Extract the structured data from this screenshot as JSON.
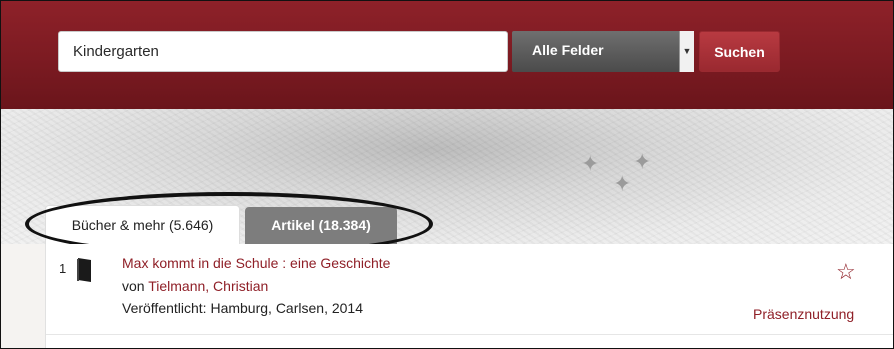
{
  "search": {
    "query": "Kindergarten",
    "field_selected": "Alle Felder",
    "button_label": "Suchen"
  },
  "tabs": [
    {
      "label": "Bücher & mehr (5.646)",
      "active": true
    },
    {
      "label": "Artikel (18.384)",
      "active": false
    }
  ],
  "results": [
    {
      "number": "1",
      "icon": "book-icon",
      "title": "Max kommt in die Schule : eine Geschichte",
      "author_prefix": "von",
      "author": "Tielmann, Christian",
      "published": "Veröffentlicht: Hamburg, Carlsen, 2014",
      "status": "Präsenznutzung"
    }
  ],
  "colors": {
    "brand": "#7a1a21",
    "accent": "#8f1f27",
    "tab_inactive": "#7d7d7d"
  }
}
